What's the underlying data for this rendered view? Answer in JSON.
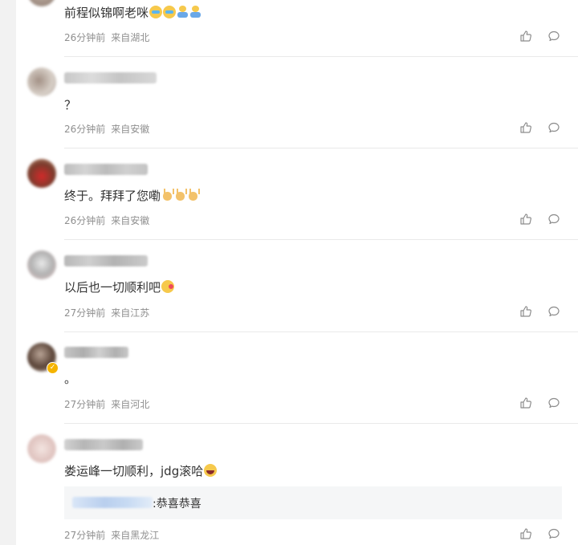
{
  "comments": [
    {
      "text": "前程似锦啊老咪",
      "time": "26分钟前",
      "location": "来自湖北",
      "emojis": [
        "cry",
        "cry",
        "kid",
        "kid"
      ]
    },
    {
      "text": "？",
      "time": "26分钟前",
      "location": "来自安徽",
      "emojis": []
    },
    {
      "text": "终于。拜拜了您嘞",
      "time": "26分钟前",
      "location": "来自安徽",
      "emojis": [
        "hand",
        "hand",
        "hand"
      ]
    },
    {
      "text": "以后也一切顺利吧",
      "time": "27分钟前",
      "location": "来自江苏",
      "emojis": [
        "kiss"
      ]
    },
    {
      "text": "。",
      "time": "27分钟前",
      "location": "来自河北",
      "emojis": []
    },
    {
      "text": "娄运峰一切顺利，jdg滚哈",
      "time": "27分钟前",
      "location": "来自黑龙江",
      "emojis": [
        "laugh"
      ],
      "reply": {
        "text": ":恭喜恭喜"
      }
    }
  ],
  "icons": {
    "like": "thumbs-up-icon",
    "reply": "speech-bubble-icon"
  },
  "colors": {
    "meta": "#8f8f8f",
    "text": "#333333",
    "reply_bg": "#f5f6f7",
    "username_blur": "#b9cfee"
  }
}
